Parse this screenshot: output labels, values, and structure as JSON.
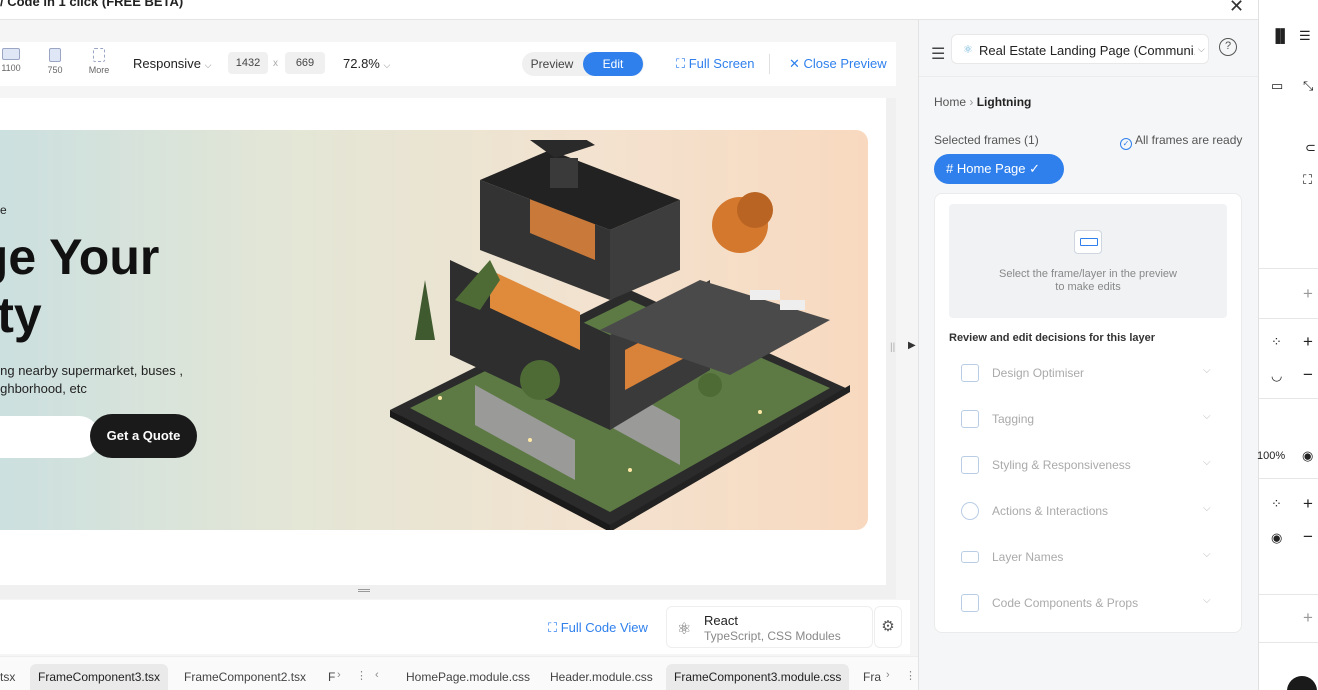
{
  "window": {
    "title": "/ Code in 1 click (FREE BETA)"
  },
  "toolbar": {
    "devices": [
      {
        "label": "1100"
      },
      {
        "label": "750"
      },
      {
        "label": "More"
      }
    ],
    "viewport_mode": "Responsive",
    "width": "1432",
    "height": "669",
    "times": "x",
    "zoom": "72.8%",
    "preview_label": "Preview",
    "edit_label": "Edit",
    "full_screen": "Full Screen",
    "close_preview": "Close Preview"
  },
  "hero": {
    "eyebrow": "e",
    "headline_1": "age Your",
    "headline_2": "erty",
    "desc_1": "hing nearby supermarket, buses ,",
    "desc_2": "eighborhood, etc",
    "cta": "Get a Quote"
  },
  "codebar": {
    "full_code_view": "Full Code View",
    "framework": "React",
    "framework_sub": "TypeScript, CSS Modules"
  },
  "tabs": {
    "left": [
      "tsx",
      "FrameComponent3.tsx",
      "FrameComponent2.tsx",
      "F"
    ],
    "right": [
      "HomePage.module.css",
      "Header.module.css",
      "FrameComponent3.module.css",
      "Fra"
    ]
  },
  "panel": {
    "project": "Real Estate Landing Page (Communi...",
    "breadcrumb_home": "Home",
    "breadcrumb_current": "Lightning",
    "selected_frames": "Selected frames (1)",
    "frames_ready": "All frames are ready",
    "frame_chip": "Home Page",
    "hint_1": "Select the frame/layer in the preview",
    "hint_2": "to make edits",
    "review_title": "Review and edit decisions for this layer",
    "sections": [
      "Design Optimiser",
      "Tagging",
      "Styling & Responsiveness",
      "Actions & Interactions",
      "Layer Names",
      "Code Components & Props"
    ]
  },
  "strip": {
    "opacity": "100%"
  },
  "colors": {
    "accent": "#2f80ed",
    "cta": "#1a1a1a"
  }
}
